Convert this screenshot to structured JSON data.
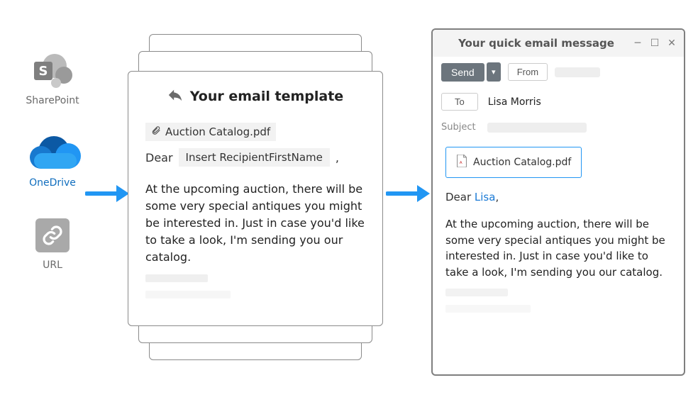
{
  "sources": {
    "sharepoint": {
      "label": "SharePoint",
      "initial": "S"
    },
    "onedrive": {
      "label": "OneDrive"
    },
    "url": {
      "label": "URL"
    }
  },
  "template": {
    "title": "Your email template",
    "attachment_name": "Auction Catalog.pdf",
    "greeting_prefix": "Dear",
    "macro_label": "Insert RecipientFirstName",
    "greeting_suffix": ",",
    "body": "At the upcoming auction, there will be some very special antiques you might be interested in. Just in case you'd like to take a look, I'm sending you our catalog."
  },
  "email": {
    "window_title": "Your quick email message",
    "send_label": "Send",
    "from_label": "From",
    "to_label": "To",
    "to_value": "Lisa Morris",
    "subject_label": "Subject",
    "attachment_name": "Auction Catalog.pdf",
    "greeting_prefix": "Dear ",
    "greeting_name": "Lisa",
    "greeting_suffix": ",",
    "body": "At the upcoming auction, there will be some very special antiques you might be interested in. Just in case you'd like to take a look, I'm sending you our catalog."
  }
}
